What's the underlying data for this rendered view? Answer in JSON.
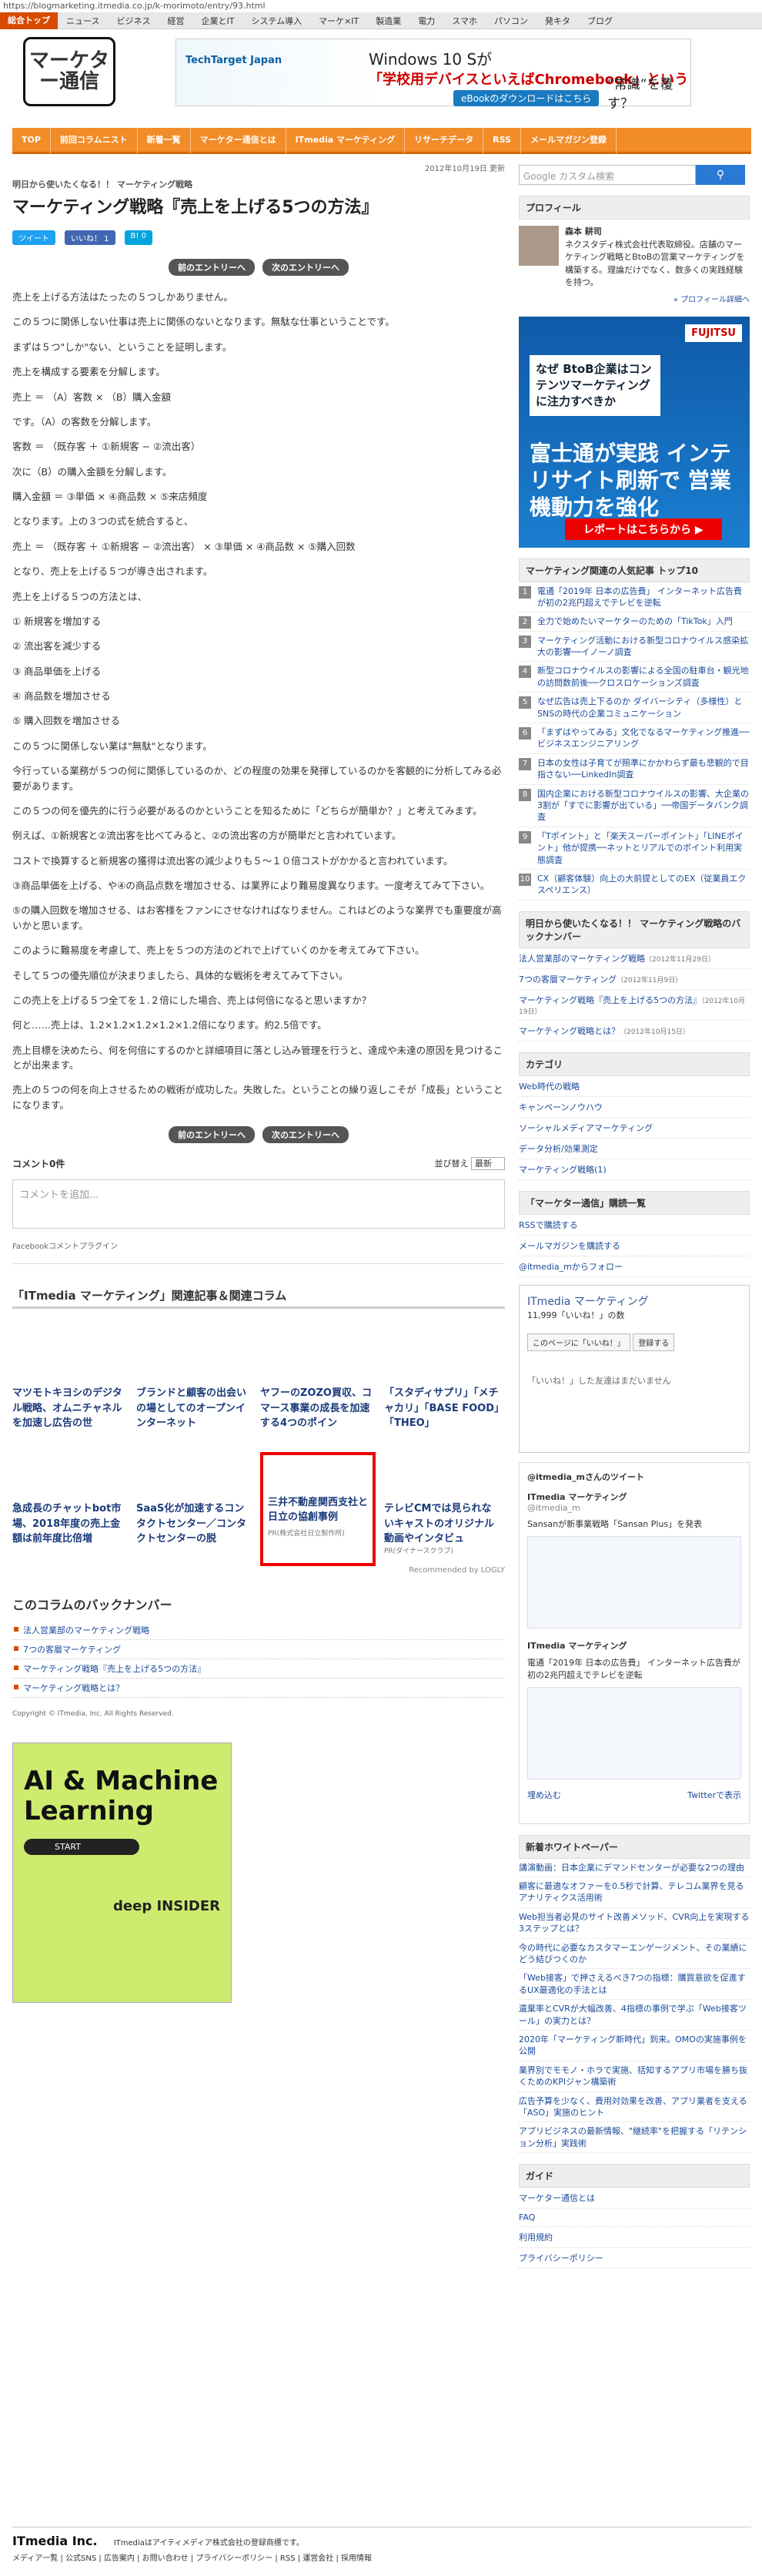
{
  "url": "https://blogmarketing.itmedia.co.jp/k-morimoto/entry/93.html",
  "topnav": {
    "current": "総合トップ",
    "items": [
      "ニュース",
      "ビジネス",
      "経営",
      "企業とIT",
      "システム導入",
      "マーケ×IT",
      "製造業",
      "電力",
      "スマホ",
      "パソコン",
      "発キタ",
      "ブログ"
    ]
  },
  "logo": "マーケター通信",
  "banner": {
    "brand": "TechTarget Japan",
    "line1": "Windows 10 Sが",
    "line2": "「学校用デバイスといえばChromebook」という",
    "line3": "“常識”を覆す？",
    "cta": "eBookのダウンロードはこちら"
  },
  "gnav": [
    "TOP",
    "前回コラムニスト",
    "新着一覧",
    "マーケター通信とは",
    "ITmedia マーケティング",
    "リサーチデータ",
    "RSS",
    "メールマガジン登録"
  ],
  "article": {
    "date": "2012年10月19日 更新",
    "category": "明日から使いたくなる！！ マーケティング戦略",
    "title": "マーケティング戦略『売上を上げる5つの方法』",
    "tweet": "ツイート",
    "like": "いいね！ 1",
    "bookmark": "B! 0",
    "prev": "前のエントリーへ",
    "next": "次のエントリーへ",
    "paragraphs": [
      "売上を上げる方法はたったの５つしかありません。",
      "この５つに関係しない仕事は売上に関係のないとなります。無駄な仕事ということです。",
      "まずは５つ\"しか\"ない、ということを証明します。",
      "売上を構成する要素を分解します。",
      "売上 ＝ （A）客数 × （B）購入金額",
      "です。（A）の客数を分解します。",
      "客数 ＝ （既存客 ＋ ①新規客 − ②流出客）",
      "次に（B）の購入金額を分解します。",
      "購入金額 ＝ ③単価 × ④商品数 × ⑤来店頻度",
      "となります。上の３つの式を統合すると、",
      "売上 ＝ （既存客 ＋ ①新規客 − ②流出客） × ③単価 × ④商品数 × ⑤購入回数",
      "となり、売上を上げる５つが導き出されます。",
      "売上を上げる５つの方法とは、",
      "① 新規客を増加する",
      "② 流出客を減少する",
      "③ 商品単価を上げる",
      "④ 商品数を増加させる",
      "⑤ 購入回数を増加させる",
      "この５つに関係しない業は\"無駄\"となります。",
      "今行っている業務が５つの何に関係しているのか、どの程度の効果を発揮しているのかを客観的に分析してみる必要があります。",
      "この５つの何を優先的に行う必要があるのかということを知るために「どちらが簡単か？」と考えてみます。",
      "例えば、①新規客と②流出客を比べてみると、②の流出客の方が簡単だと言われています。",
      "コストで換算すると新規客の獲得は流出客の減少よりも５〜１０倍コストがかかると言われています。",
      "③商品単価を上げる、や④の商品点数を増加させる、は業界により難易度異なります。一度考えてみて下さい。",
      "⑤の購入回数を増加させる、はお客様をファンにさせなければなりません。これはどのような業界でも重要度が高いかと思います。",
      "このように難易度を考慮して、売上を５つの方法のどれで上げていくのかを考えてみて下さい。",
      "そして５つの優先順位が決まりましたら、具体的な戦術を考えてみて下さい。",
      "この売上を上げる５つ全てを１.２倍にした場合、売上は何倍になると思いますか？",
      "何と……売上は、1.2×1.2×1.2×1.2×1.2倍になります。約2.5倍です。",
      "売上目標を決めたら、何を何倍にするのかと詳細項目に落とし込み管理を行うと、達成や未達の原因を見つけることが出来ます。",
      "売上の５つの何を向上させるための戦術が成功した。失敗した。ということの繰り返しこそが「成長」ということになります。"
    ],
    "comments": {
      "title": "コメント0件",
      "sort_label": "並び替え",
      "sort_value": "最新",
      "placeholder": "コメントを追加...",
      "plugin": "Facebookコメントプラグイン"
    }
  },
  "related": {
    "title": "「ITmedia マーケティング」関連記事＆関連コラム",
    "items": [
      "マツモトキヨシのデジタル戦略、オムニチャネルを加速し広告の世",
      "ブランドと顧客の出会いの場としてのオープンインターネット",
      "ヤフーのZOZO買収、コマース事業の成長を加速する4つのポイン",
      "「スタディサプリ」「メチャカリ」「BASE FOOD」「THEO」",
      "急成長のチャットbot市場、2018年度の売上金額は前年度比倍増",
      "SaaS化が加速するコンタクトセンター／コンタクトセンターの脱",
      "三井不動産関西支社と日立の協創事例",
      "テレビCMでは見られないキャストのオリジナル動画やインタビュ"
    ],
    "pr1": "PR(株式会社日立製作所)",
    "pr2": "PR(ダイナースクラブ)",
    "recommended": "Recommended by LOGLY"
  },
  "backnumber": {
    "title": "このコラムのバックナンバー",
    "items": [
      "法人営業部のマーケティング戦略",
      "7つの客層マーケティング",
      "マーケティング戦略『売上を上げる5つの方法』",
      "マーケティング戦略とは？"
    ]
  },
  "copyright": "Copyright © ITmedia, Inc. All Rights Reserved.",
  "ad_deep": {
    "title": "AI & Machine Learning",
    "start": "START",
    "brand": "deep INSIDER"
  },
  "sidebar": {
    "search_placeholder": "Google カスタム検索",
    "search_btn": "検索",
    "profile_title": "プロフィール",
    "author": "森本 耕司",
    "bio": "ネクスタディ株式会社代表取締役。店舗のマーケティング戦略とBtoBの営業マーケティングを構築する。理論だけでなく、数多くの実践経験を持つ。",
    "more_profile": "» プロフィール詳細へ",
    "fujitsu": {
      "logo": "FUJITSU",
      "q": "なぜ BtoB企業はコンテンツマーケティングに注力すべきか",
      "big": "富士通が実践 インテリサイト刷新で 営業機動力を強化",
      "btn": "レポートはこちらから ▶"
    },
    "ranking_title": "マーケティング関連の人気記事 トップ10",
    "ranking": [
      "電通「2019年 日本の広告費」 インターネット広告費が初の2兆円超えでテレビを逆転",
      "全力で始めたいマーケターのための「TikTok」入門",
      "マーケティング活動における新型コロナウイルス感染拡大の影響──イノーノ調査",
      "新型コロナウイルスの影響による全国の駐車台・観光地の訪問数前後──クロスロケーションズ調査",
      "なぜ広告は売上下るのか ダイバーシティ（多様性）とSNSの時代の企業コミュニケーション",
      "「まずはやってみる」文化でなるマーケティング推進──ビジネスエンジニアリング",
      "日本の女性は子育てが照準にかかわらず最も悲観的で目指さない──LinkedIn調査",
      "国内企業における新型コロナウイルスの影響、大企業の3割が「すでに影響が出ている」──帝国データバンク調査",
      "「Tポイント」と「楽天スーパーポイント」「LINEポイント」他が提携──ネットとリアルでのポイント利用実態調査",
      "CX（顧客体験）向上の大前提としてのEX（従業員エクスペリエンス）"
    ],
    "series_title": "明日から使いたくなる！！ マーケティング戦略のバックナンバー",
    "series": [
      {
        "t": "法人営業部のマーケティング戦略",
        "d": "（2012年11月29日）"
      },
      {
        "t": "7つの客層マーケティング",
        "d": "（2012年11月9日）"
      },
      {
        "t": "マーケティング戦略『売上を上げる5つの方法』",
        "d": "（2012年10月19日）"
      },
      {
        "t": "マーケティング戦略とは？",
        "d": "（2012年10月15日）"
      }
    ],
    "category_title": "カテゴリ",
    "categories": [
      "Web時代の戦略",
      "キャンペーンノウハウ",
      "ソーシャルメディアマーケティング",
      "データ分析/効果測定",
      "マーケティング戦略(1)"
    ],
    "subscribe_title": "「マーケター通信」購読一覧",
    "rss": "RSSで購読する",
    "mail": "メールマガジンを購読する",
    "twfollow": "@itmedia_mからフォロー",
    "fb": {
      "name": "ITmedia マーケティング",
      "likes": "11,999「いいね！」の数",
      "like_btn": "このページに「いいね！」",
      "reg": "登録する",
      "empty": "「いいね！」した友達はまだいません"
    },
    "tw": {
      "title": "@itmedia_mさんのツイート",
      "name": "ITmedia マーケティング",
      "handle": "@itmedia_m",
      "t1": "Sansanが新事業戦略「Sansan Plus」を発表",
      "t2": "電通「2019年 日本の広告費」 インターネット広告費が初の2兆円超えでテレビを逆転",
      "embed": "埋め込む",
      "view": "Twitterで表示"
    },
    "wp_title": "新着ホワイトペーパー",
    "wp": [
      "講演動画：日本企業にデマンドセンターが必要な2つの理由",
      "顧客に最適なオファーを0.5秒で計算、テレコム業界を見るアナリティクス活用術",
      "Web担当者必見のサイト改善メソッド、CVR向上を実現する3ステップとは？",
      "今の時代に必要なカスタマーエンゲージメント、その業績にどう結びつくのか",
      "「Web接客」で押さえるべき7つの指標：購買意欲を促進するUX最適化の手法とは",
      "遺棄率とCVRが大幅改善、4指標の事例で学ぶ「Web接客ツール」の実力とは？",
      "2020年「マーケティング新時代」到来。OMOの実施事例を公開",
      "業界別でモモノ・ホラで実施、括知するアプリ市場を勝ち抜くためのKPIジャン構築術",
      "広告予算を少なく、費用対効果を改善、アプリ業者を支える「ASO」実施のヒント",
      "アプリビジネスの最新情報、\"継続率\"を把握する「リテンション分析」実践術"
    ],
    "guide_title": "ガイド",
    "guide": [
      "マーケター通信とは",
      "FAQ",
      "利用規約",
      "プライバシーポリシー"
    ]
  },
  "footer": {
    "logo": "ITmedia Inc.",
    "note": "ITmediaはアイティメディア株式会社の登録商標です。",
    "links": "メディア一覧 | 公式SNS | 広告案内 | お問い合わせ | プライバシーポリシー | RSS | 運営会社 | 採用情報"
  }
}
